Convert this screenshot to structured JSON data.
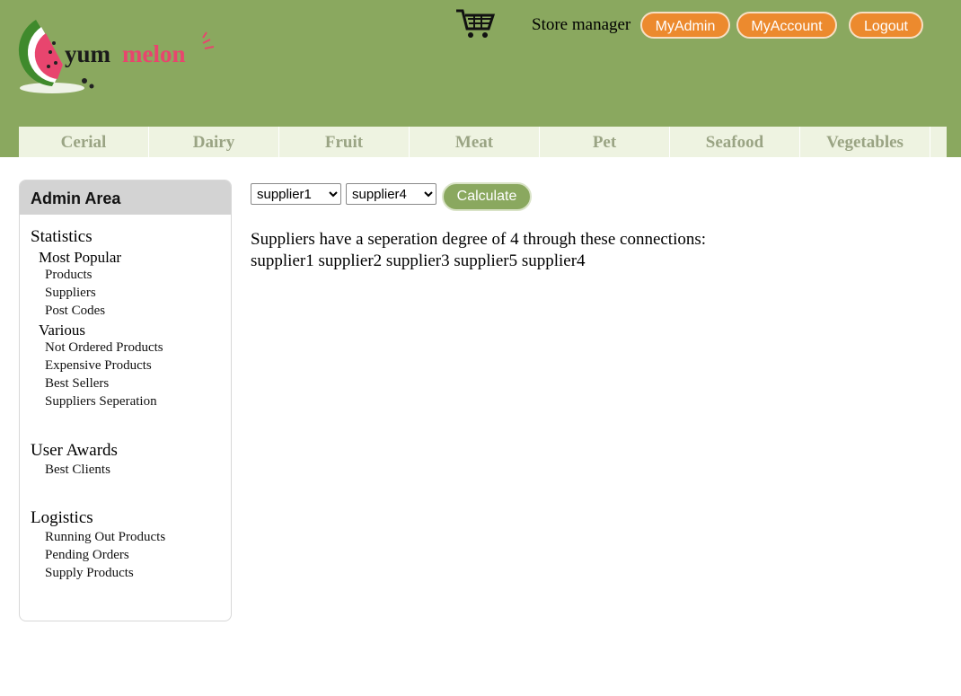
{
  "header": {
    "logo_text": "yummelon",
    "store_manager_label": "Store manager",
    "buttons": {
      "admin": "MyAdmin",
      "account": "MyAccount",
      "logout": "Logout"
    }
  },
  "nav": {
    "items": [
      "Cerial",
      "Dairy",
      "Fruit",
      "Meat",
      "Pet",
      "Seafood",
      "Vegetables"
    ]
  },
  "sidebar": {
    "title": "Admin Area",
    "statistics": {
      "label": "Statistics",
      "most_popular": {
        "label": "Most Popular",
        "links": [
          "Products",
          "Suppliers",
          "Post Codes"
        ]
      },
      "various": {
        "label": "Various",
        "links": [
          "Not Ordered Products",
          "Expensive Products",
          "Best Sellers",
          "Suppliers Seperation"
        ]
      }
    },
    "user_awards": {
      "label": "User Awards",
      "links": [
        "Best Clients"
      ]
    },
    "logistics": {
      "label": "Logistics",
      "links": [
        "Running Out Products",
        "Pending Orders",
        "Supply Products"
      ]
    }
  },
  "main": {
    "supplier_from": "supplier1",
    "supplier_to": "supplier4",
    "calculate_label": "Calculate",
    "result_line1": "Suppliers have a seperation degree of 4 through these connections:",
    "result_line2": "supplier1 supplier2 supplier3 supplier5 supplier4"
  },
  "colors": {
    "header_bg": "#8aa85f",
    "nav_bg": "#eef3e1",
    "accent_orange": "#ec8a2e",
    "logo_pink": "#e8456e"
  }
}
